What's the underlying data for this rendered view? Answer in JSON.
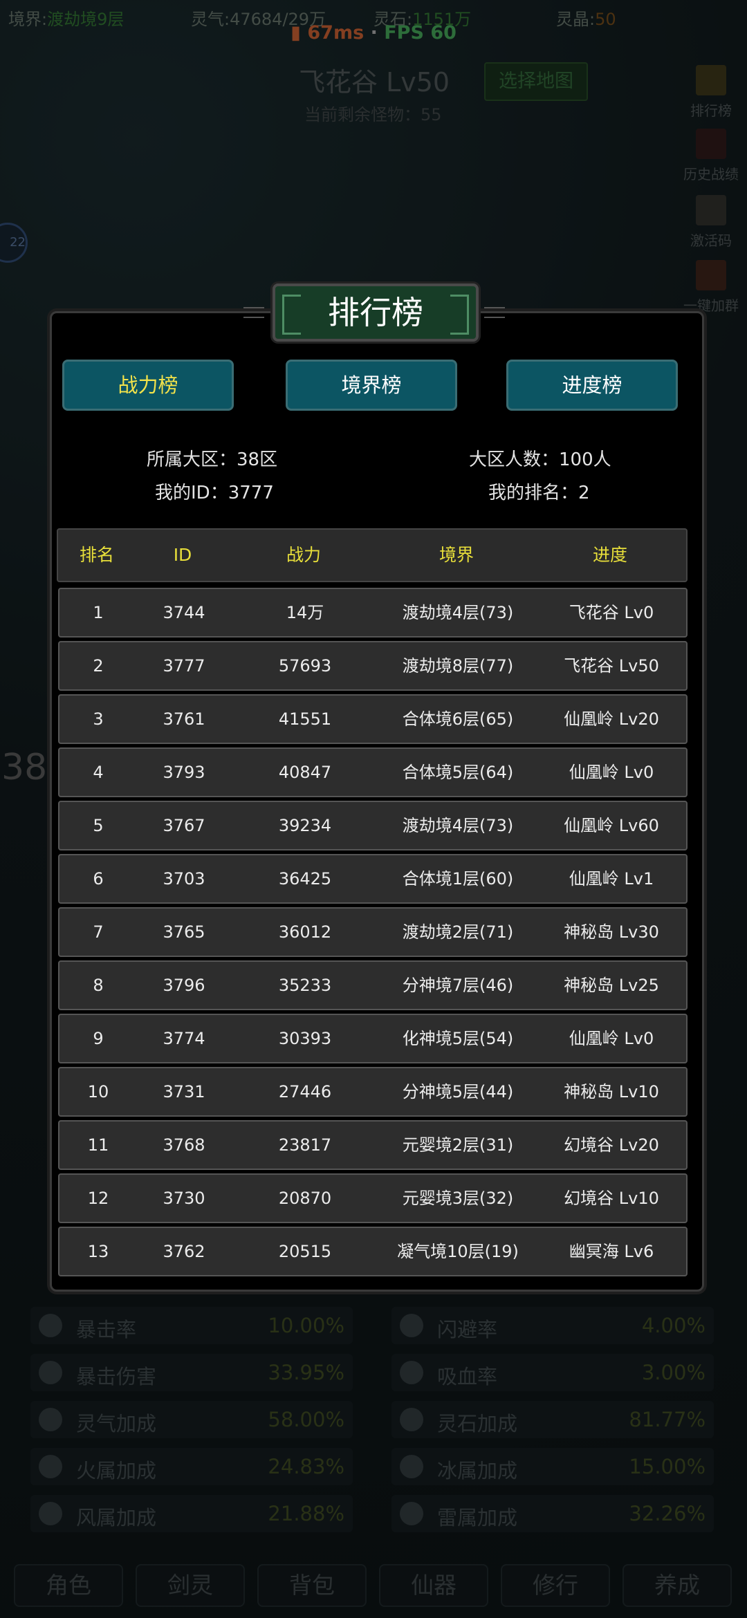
{
  "topbar": {
    "realm_label": "境界:",
    "realm_value": "渡劫境9层",
    "qi_label": "灵气:",
    "qi_value": "47684/29万",
    "stone_label": "灵石:",
    "stone_value": "1151万",
    "crystal_label": "灵晶:",
    "crystal_value": "50"
  },
  "network": {
    "ping": "67ms",
    "separator": "·",
    "fps": "FPS 60"
  },
  "map": {
    "name": "飞花谷 Lv50",
    "remaining": "当前剩余怪物：55",
    "select_button": "选择地图"
  },
  "side_menu": [
    "排行榜",
    "历史战绩",
    "激活码",
    "一键加群"
  ],
  "avatar_level": "22",
  "bg_number": "38",
  "modal": {
    "title": "排行榜",
    "tabs": [
      {
        "label": "战力榜",
        "active": true
      },
      {
        "label": "境界榜",
        "active": false
      },
      {
        "label": "进度榜",
        "active": false
      }
    ],
    "info": {
      "region": "所属大区：38区",
      "population": "大区人数：100人",
      "my_id": "我的ID：3777",
      "my_rank": "我的排名：2"
    },
    "columns": [
      "排名",
      "ID",
      "战力",
      "境界",
      "进度"
    ],
    "rows": [
      [
        "1",
        "3744",
        "14万",
        "渡劫境4层(73)",
        "飞花谷 Lv0"
      ],
      [
        "2",
        "3777",
        "57693",
        "渡劫境8层(77)",
        "飞花谷 Lv50"
      ],
      [
        "3",
        "3761",
        "41551",
        "合体境6层(65)",
        "仙凰岭 Lv20"
      ],
      [
        "4",
        "3793",
        "40847",
        "合体境5层(64)",
        "仙凰岭 Lv0"
      ],
      [
        "5",
        "3767",
        "39234",
        "渡劫境4层(73)",
        "仙凰岭 Lv60"
      ],
      [
        "6",
        "3703",
        "36425",
        "合体境1层(60)",
        "仙凰岭 Lv1"
      ],
      [
        "7",
        "3765",
        "36012",
        "渡劫境2层(71)",
        "神秘岛 Lv30"
      ],
      [
        "8",
        "3796",
        "35233",
        "分神境7层(46)",
        "神秘岛 Lv25"
      ],
      [
        "9",
        "3774",
        "30393",
        "化神境5层(54)",
        "仙凰岭 Lv0"
      ],
      [
        "10",
        "3731",
        "27446",
        "分神境5层(44)",
        "神秘岛 Lv10"
      ],
      [
        "11",
        "3768",
        "23817",
        "元婴境2层(31)",
        "幻境谷 Lv20"
      ],
      [
        "12",
        "3730",
        "20870",
        "元婴境3层(32)",
        "幻境谷 Lv10"
      ],
      [
        "13",
        "3762",
        "20515",
        "凝气境10层(19)",
        "幽冥海 Lv6"
      ]
    ]
  },
  "stats": [
    {
      "label": "暴击率",
      "value": "10.00%"
    },
    {
      "label": "闪避率",
      "value": "4.00%"
    },
    {
      "label": "暴击伤害",
      "value": "33.95%"
    },
    {
      "label": "吸血率",
      "value": "3.00%"
    },
    {
      "label": "灵气加成",
      "value": "58.00%"
    },
    {
      "label": "灵石加成",
      "value": "81.77%"
    },
    {
      "label": "火属加成",
      "value": "24.83%"
    },
    {
      "label": "冰属加成",
      "value": "15.00%"
    },
    {
      "label": "风属加成",
      "value": "21.88%"
    },
    {
      "label": "雷属加成",
      "value": "32.26%"
    }
  ],
  "bottom_nav": [
    "角色",
    "剑灵",
    "背包",
    "仙器",
    "修行",
    "养成"
  ]
}
